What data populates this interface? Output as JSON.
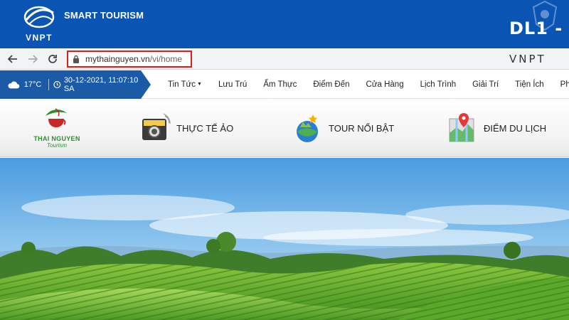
{
  "banner": {
    "logo_text": "VNPT",
    "title": "SMART TOURISM",
    "right_text": "DL1 -"
  },
  "browser": {
    "url_host": "mythainguyen.vn",
    "url_path": "/vi/home",
    "brand": "VNPT"
  },
  "top_bar": {
    "temperature": "17°C",
    "datetime": "30-12-2021, 11:07:10 SA"
  },
  "nav": {
    "items": [
      "Tin Tức",
      "Lưu Trú",
      "Ẩm Thực",
      "Điểm Đến",
      "Cửa Hàng",
      "Lịch Trình",
      "Giải Trí",
      "Tiện Ích",
      "Ph"
    ]
  },
  "site_logo": {
    "line1": "THAI NGUYEN",
    "line2": "Tourism"
  },
  "features": [
    {
      "label": "THỰC TẾ ẢO",
      "icon": "vr-camera-icon"
    },
    {
      "label": "TOUR NỔI BẬT",
      "icon": "globe-tour-icon"
    },
    {
      "label": "ĐIỂM DU LỊCH",
      "icon": "map-pin-icon"
    }
  ],
  "colors": {
    "banner": "#0a54b4",
    "weather_box": "#1a5aa6",
    "url_highlight": "#d42020",
    "logo_green": "#2f8f2f"
  }
}
